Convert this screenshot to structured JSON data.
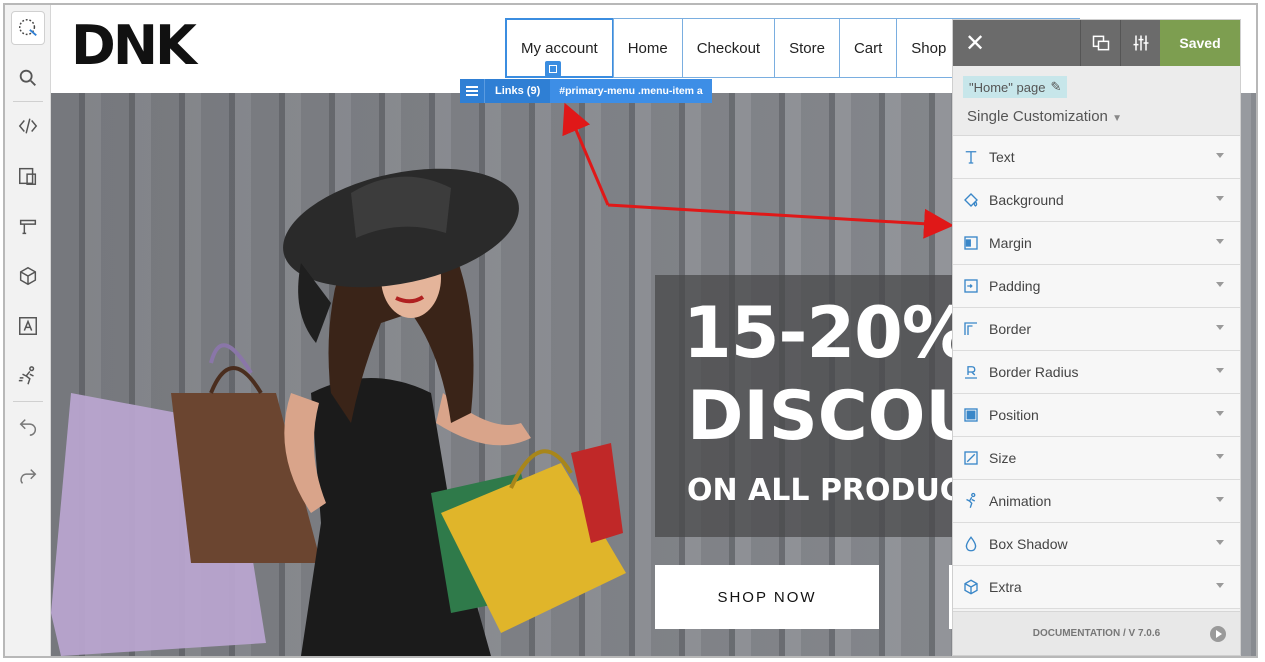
{
  "site": {
    "logo": "DNK",
    "menu": [
      "My account",
      "Home",
      "Checkout",
      "Store",
      "Cart",
      "Shop"
    ]
  },
  "selection": {
    "links_label": "Links (9)",
    "selector": "#primary-menu .menu-item a"
  },
  "hero": {
    "line1": "15-20%",
    "line2": "DISCOU",
    "line3": "ON ALL PRODUCT",
    "button": "SHOP NOW"
  },
  "panel": {
    "saved_label": "Saved",
    "page_chip": "\"Home\" page",
    "mode": "Single Customization",
    "properties": [
      {
        "label": "Text",
        "icon": "text-icon"
      },
      {
        "label": "Background",
        "icon": "paint-bucket-icon"
      },
      {
        "label": "Margin",
        "icon": "margin-icon"
      },
      {
        "label": "Padding",
        "icon": "padding-icon"
      },
      {
        "label": "Border",
        "icon": "border-icon"
      },
      {
        "label": "Border Radius",
        "icon": "border-radius-icon"
      },
      {
        "label": "Position",
        "icon": "position-icon"
      },
      {
        "label": "Size",
        "icon": "size-icon"
      },
      {
        "label": "Animation",
        "icon": "animation-icon"
      },
      {
        "label": "Box Shadow",
        "icon": "drop-icon"
      },
      {
        "label": "Extra",
        "icon": "cube-icon"
      }
    ],
    "footer": "DOCUMENTATION / V 7.0.6"
  },
  "colors": {
    "accent_blue": "#2f7fd4",
    "saved_green": "#7d9e50",
    "panel_dark": "#6b6b6b",
    "arrow_red": "#e01818"
  }
}
